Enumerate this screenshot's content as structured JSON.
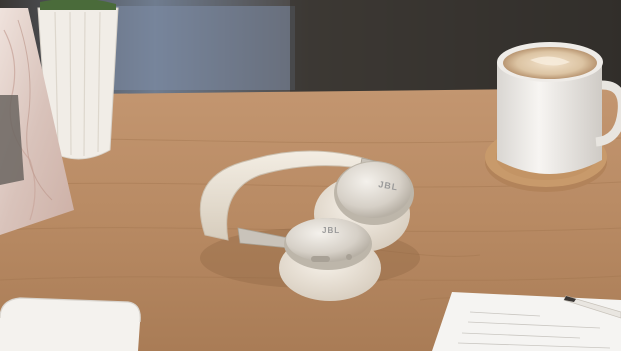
{
  "photo": {
    "headphones": {
      "brand_mark": "JBL"
    },
    "colors": {
      "table_wood": "#b88a63",
      "wall_back": "#3b3733",
      "headphone_cream": "#ece5da",
      "headphone_metal": "#cfc9bf",
      "coaster_cork": "#c89a6b",
      "mug_white": "#f3f1ee",
      "latte_foam": "#e8d5bd"
    }
  }
}
